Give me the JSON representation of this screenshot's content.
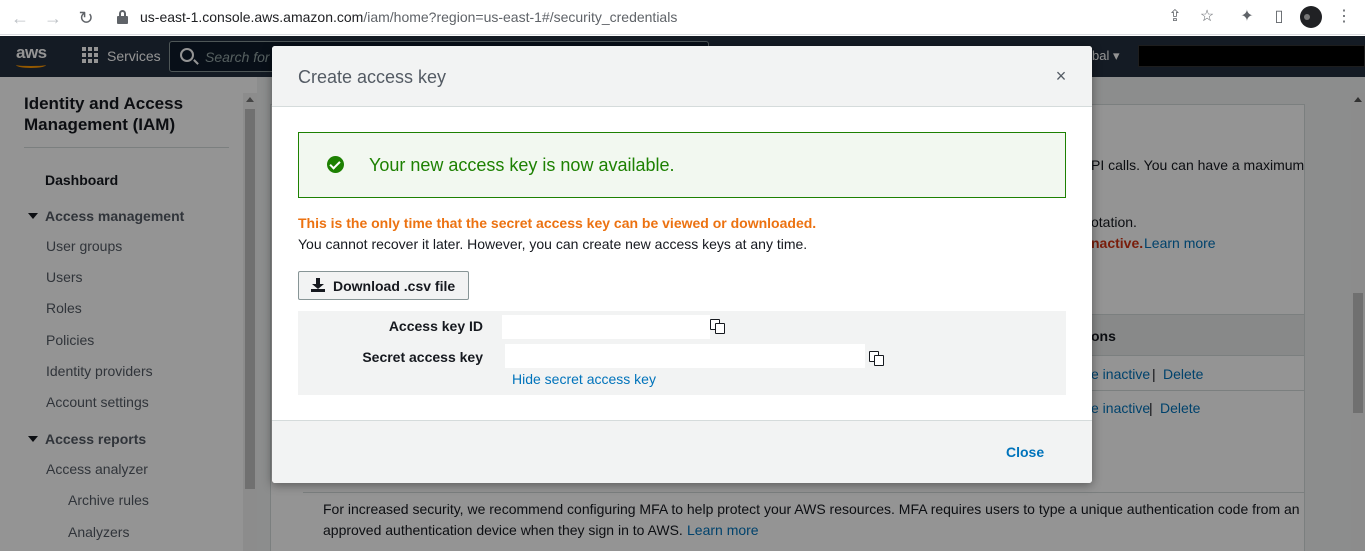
{
  "browser": {
    "url_host": "us-east-1.console.aws.amazon.com",
    "url_path": "/iam/home?region=us-east-1#/security_credentials"
  },
  "aws_bar": {
    "logo": "aws",
    "services_label": "Services",
    "search_placeholder": "Search for",
    "region_label": "bal ▾"
  },
  "sidebar": {
    "title": "Identity and Access Management (IAM)",
    "dashboard": "Dashboard",
    "section_access_management": "Access management",
    "access_management_items": [
      "User groups",
      "Users",
      "Roles",
      "Policies",
      "Identity providers",
      "Account settings"
    ],
    "section_access_reports": "Access reports",
    "access_reports_items": [
      "Access analyzer",
      "Archive rules",
      "Analyzers"
    ]
  },
  "background": {
    "api_calls_text": "PI calls. You can have a maximum",
    "rotation_text": "otation.",
    "inactive_text": "nactive.",
    "learn_more": "Learn more",
    "actions_header": "ons",
    "row1_inactive": "e inactive",
    "row1_sep": "|",
    "row1_delete": "Delete",
    "row2_inactive": "e inactive",
    "row2_sep": "|",
    "row2_delete": "Delete",
    "mfa_text_1": "For increased security, we recommend configuring MFA to help protect your AWS resources. MFA requires users to type a unique authentication code from an",
    "mfa_text_2": "approved authentication device when they sign in to AWS.",
    "mfa_learn_more": "Learn more"
  },
  "modal": {
    "title": "Create access key",
    "close_x": "×",
    "success_message": "Your new access key is now available.",
    "warning": "This is the only time that the secret access key can be viewed or downloaded.",
    "note": "You cannot recover it later. However, you can create new access keys at any time.",
    "download_label": "Download .csv file",
    "access_key_id_label": "Access key ID",
    "access_key_id_value": "",
    "secret_key_label": "Secret access key",
    "secret_key_value": "",
    "hide_secret_label": "Hide secret access key",
    "close_label": "Close"
  },
  "colors": {
    "aws_bar": "#232f3e",
    "aws_orange": "#ff9900",
    "success_green": "#1d8102",
    "warning_orange": "#ec7211",
    "link_blue": "#0073bb"
  }
}
